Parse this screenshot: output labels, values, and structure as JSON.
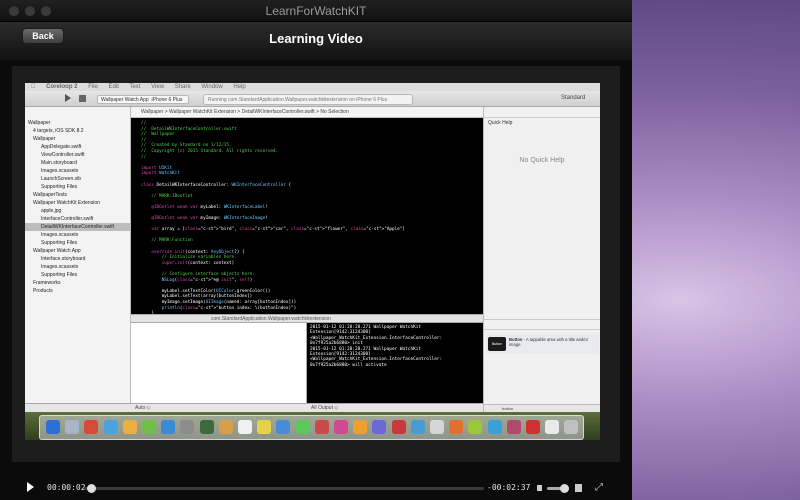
{
  "window": {
    "title": "LearnForWatchKIT"
  },
  "header": {
    "back_label": "Back",
    "page_title": "Learning Video"
  },
  "video_frame": {
    "menubar": [
      "Coreloop 2",
      "File",
      "Edit",
      "Text",
      "View",
      "Share",
      "Window",
      "Help"
    ],
    "toolbar": {
      "scheme": "Wallpaper Watch App",
      "device": "iPhone 6 Plus",
      "status": "Running com.StandardApplication.Wallpaper.watchkitextension on iPhone 6 Plus",
      "editor_mode": "Standard"
    },
    "navigator": {
      "items": [
        "Wallpaper",
        "4 targets, iOS SDK 8.2",
        "Wallpaper",
        "AppDelegate.swift",
        "ViewController.swift",
        "Main.storyboard",
        "Images.xcassets",
        "LaunchScreen.xib",
        "Supporting Files",
        "WallpaperTests",
        "Wallpaper WatchKit Extension",
        "apple.jpg",
        "InterfaceController.swift",
        "DetailWKInterfaceController.swift",
        "Images.xcassets",
        "Supporting Files",
        "Wallpaper Watch App",
        "Interface.storyboard",
        "Images.xcassets",
        "Supporting Files",
        "Frameworks",
        "Products"
      ],
      "selected_index": 13
    },
    "jump_bar": "Wallpaper  >  Wallpaper WatchKit Extension  >  DetailWKInterfaceController.swift  >  No Selection",
    "code": [
      "//",
      "//  DetailWKInterfaceController.swift",
      "//  Wallpaper",
      "//",
      "//  Created by Standard on 1/12/15.",
      "//  Copyright (c) 2015 Standard. All rights reserved.",
      "//",
      "",
      "import UIKit",
      "import WatchKit",
      "",
      "class DetailWKInterfaceController: WKInterfaceController {",
      "",
      "    // MARK:IBoutlet",
      "",
      "    @IBOutlet weak var myLabel: WKInterfaceLabel!",
      "",
      "    @IBOutlet weak var myImage: WKInterfaceImage!",
      "",
      "    var array = [\"bird\", \"car\", \"flower\", \"Apple\"]",
      "",
      "    // MARK:Function",
      "",
      "    override init(context: AnyObject?) {",
      "        // Initialize variables here.",
      "        super.init(context: context)",
      "",
      "        // Configure interface objects here.",
      "        NSLog(\"%@ init\", self)",
      "",
      "        myLabel.setTextColor(UIColor.greenColor())",
      "        myLabel.setText(array[buttonIndex])",
      "        myImage.setImage(UIImage(named: array[buttonIndex]))",
      "        println(\"button index: \\(buttonIndex)\")",
      "    }",
      "",
      "    override func willActivate() {"
    ],
    "debug_path": "com.StandardApplication.Wallpaper.watchkitextension",
    "console": [
      "2015-01-12 01:28:28.271 Wallpaper WatchKit",
      "Extension[9142:3124300]",
      "<Wallpaper_WatchKit_Extension.InterfaceController:",
      "0x7f925a2b6880> init",
      "2015-01-12 01:28:28.271 Wallpaper WatchKit",
      "Extension[9142:3124300]",
      "<Wallpaper_WatchKit_Extension.InterfaceController:",
      "0x7f925a2b6880> will activate"
    ],
    "bottom": {
      "auto_label": "Auto ◇",
      "output_label": "All Output ◇"
    },
    "inspector": {
      "quick_help_title": "Quick Help",
      "no_quick_help": "No Quick Help",
      "library_item": {
        "thumb_label": "Button",
        "title": "Button",
        "description": " - A tappable area with a title and/or image."
      },
      "filter_text": "button"
    },
    "dock_colors": [
      "#2c6fd6",
      "#aab4c8",
      "#d64a3a",
      "#4aa3e0",
      "#e8b040",
      "#6fbf4a",
      "#3a8ad6",
      "#8c8c8c",
      "#3c6a3c",
      "#d6a04a",
      "#f0f0f0",
      "#e6d24a",
      "#4a8ad6",
      "#5ac85a",
      "#c84a4a",
      "#d04a90",
      "#f0a030",
      "#6a6ad6",
      "#c83a3a",
      "#4a9ad6",
      "#d6d6d6",
      "#e07030",
      "#9ac83a",
      "#3aa0d6",
      "#b04a6a",
      "#d03030",
      "#eaeaea",
      "#c0c0c0"
    ]
  },
  "player": {
    "current_time": "00:00:02",
    "remaining_time": "-00:02:37",
    "progress": 0.013,
    "volume": 0.75
  }
}
